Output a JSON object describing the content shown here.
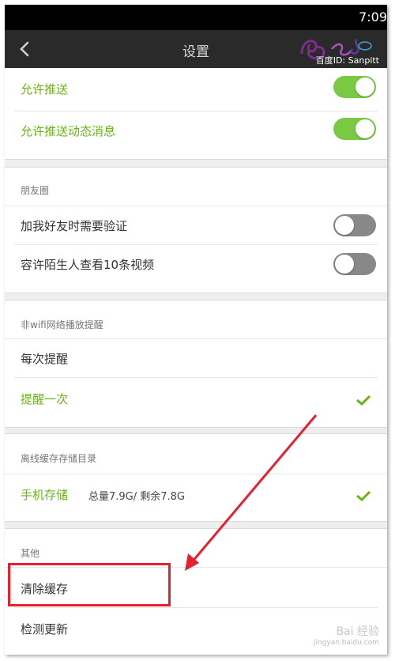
{
  "status_bar": {
    "time": "7:09"
  },
  "header": {
    "title": "设置"
  },
  "watermark": {
    "top_text": "百度ID: Sanpitt",
    "bottom_brand": "Bai 经验",
    "bottom_url": "jingyan.baidu.com"
  },
  "push": {
    "allow_push": {
      "label": "允许推送",
      "on": true
    },
    "allow_push_dynamic": {
      "label": "允许推送动态消息",
      "on": true
    }
  },
  "moments": {
    "header": "朋友圈",
    "verify_on_add": {
      "label": "加我好友时需要验证",
      "on": false
    },
    "stranger_view": {
      "label": "容许陌生人查看10条视频",
      "on": false
    }
  },
  "non_wifi": {
    "header": "非wifi网络播放提醒",
    "options": [
      {
        "label": "每次提醒",
        "selected": false
      },
      {
        "label": "提醒一次",
        "selected": true
      }
    ]
  },
  "offline_cache": {
    "header": "离线缓存存储目录",
    "phone_storage": {
      "label": "手机存储",
      "info": "总量7.9G/ 剩余7.8G",
      "selected": true
    }
  },
  "other": {
    "header": "其他",
    "clear_cache": "清除缓存",
    "check_update": "检测更新"
  },
  "colors": {
    "accent_green": "#6ab515",
    "toggle_on": "#7ac943",
    "highlight_red": "#e5212f"
  }
}
